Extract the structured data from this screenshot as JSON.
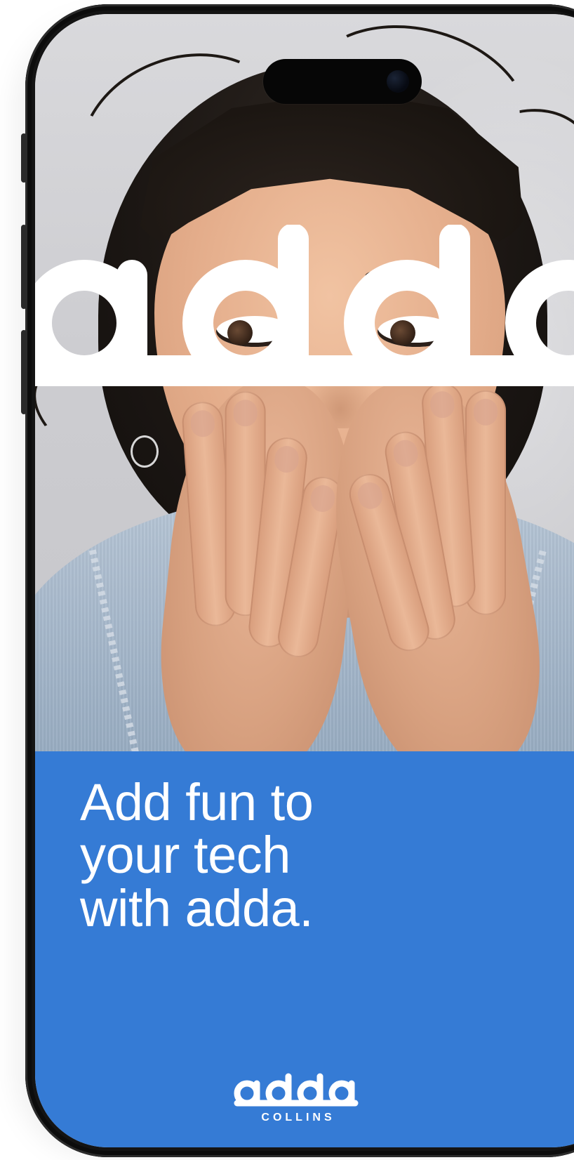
{
  "promo": {
    "hero_logo_text": "adda",
    "headline_lines": [
      "Add fun to",
      "your tech",
      "with adda."
    ],
    "brand_logo_text": "adda",
    "brand_subtext": "COLLINS"
  },
  "colors": {
    "panel_blue": "#357bd5",
    "text_white": "#ffffff",
    "phone_frame": "#141414"
  }
}
